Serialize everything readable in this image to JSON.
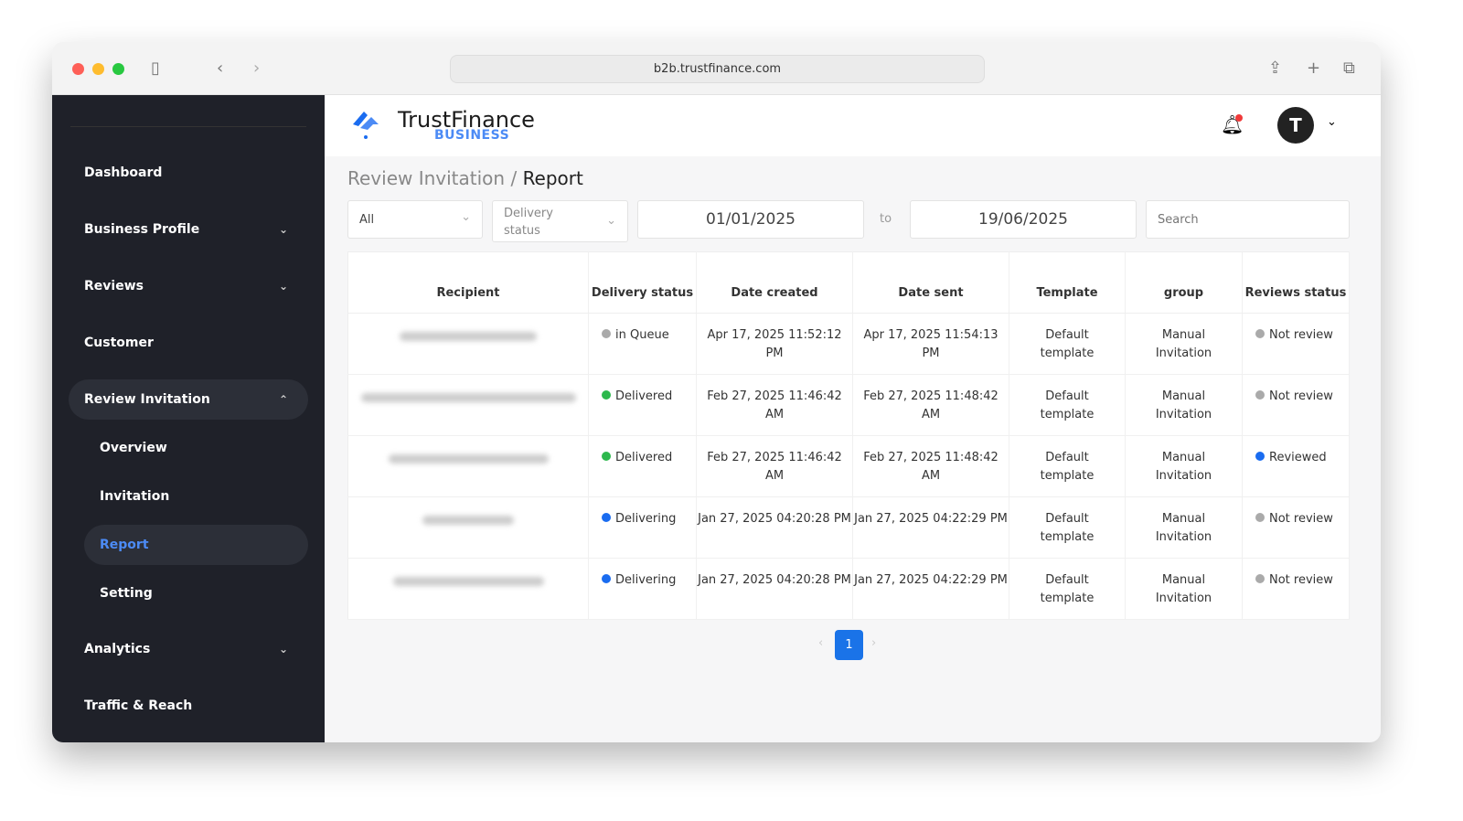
{
  "browser": {
    "url": "b2b.trustfinance.com"
  },
  "brand": {
    "name": "TrustFinance",
    "sub": "BUSINESS",
    "accent": "#4c8bf5"
  },
  "user": {
    "initial": "T"
  },
  "sidebar": {
    "items": [
      {
        "label": "Dashboard"
      },
      {
        "label": "Business Profile"
      },
      {
        "label": "Reviews"
      },
      {
        "label": "Customer"
      },
      {
        "label": "Review Invitation"
      },
      {
        "label": "Overview"
      },
      {
        "label": "Invitation"
      },
      {
        "label": "Report"
      },
      {
        "label": "Setting"
      },
      {
        "label": "Analytics"
      },
      {
        "label": "Traffic & Reach"
      }
    ]
  },
  "breadcrumb": {
    "parent": "Review Invitation",
    "sep": "/",
    "current": "Report"
  },
  "filters": {
    "type": "All",
    "delivery": "Delivery status",
    "from": "01/01/2025",
    "to_label": "to",
    "to": "19/06/2025",
    "search_placeholder": "Search"
  },
  "table": {
    "headers": [
      "Recipient",
      "Delivery status",
      "Date created",
      "Date sent",
      "Template",
      "group",
      "Reviews status"
    ],
    "rows": [
      {
        "delivery": "in Queue",
        "dcolor": "#aaaaaa",
        "created": "Apr 17, 2025 11:52:12 PM",
        "sent": "Apr 17, 2025 11:54:13 PM",
        "template": "Default template",
        "group": "Manual Invitation",
        "review": "Not review",
        "rcolor": "#aaaaaa"
      },
      {
        "delivery": "Delivered",
        "dcolor": "#2db84d",
        "created": "Feb 27, 2025 11:46:42 AM",
        "sent": "Feb 27, 2025 11:48:42 AM",
        "template": "Default template",
        "group": "Manual Invitation",
        "review": "Not review",
        "rcolor": "#aaaaaa"
      },
      {
        "delivery": "Delivered",
        "dcolor": "#2db84d",
        "created": "Feb 27, 2025 11:46:42 AM",
        "sent": "Feb 27, 2025 11:48:42 AM",
        "template": "Default template",
        "group": "Manual Invitation",
        "review": "Reviewed",
        "rcolor": "#1a6cf0"
      },
      {
        "delivery": "Delivering",
        "dcolor": "#1a6cf0",
        "created": "Jan 27, 2025 04:20:28 PM",
        "sent": "Jan 27, 2025 04:22:29 PM",
        "template": "Default template",
        "group": "Manual Invitation",
        "review": "Not review",
        "rcolor": "#aaaaaa"
      },
      {
        "delivery": "Delivering",
        "dcolor": "#1a6cf0",
        "created": "Jan 27, 2025 04:20:28 PM",
        "sent": "Jan 27, 2025 04:22:29 PM",
        "template": "Default template",
        "group": "Manual Invitation",
        "review": "Not review",
        "rcolor": "#aaaaaa"
      }
    ]
  },
  "pagination": {
    "current": "1",
    "prev": "‹",
    "next": "›"
  }
}
